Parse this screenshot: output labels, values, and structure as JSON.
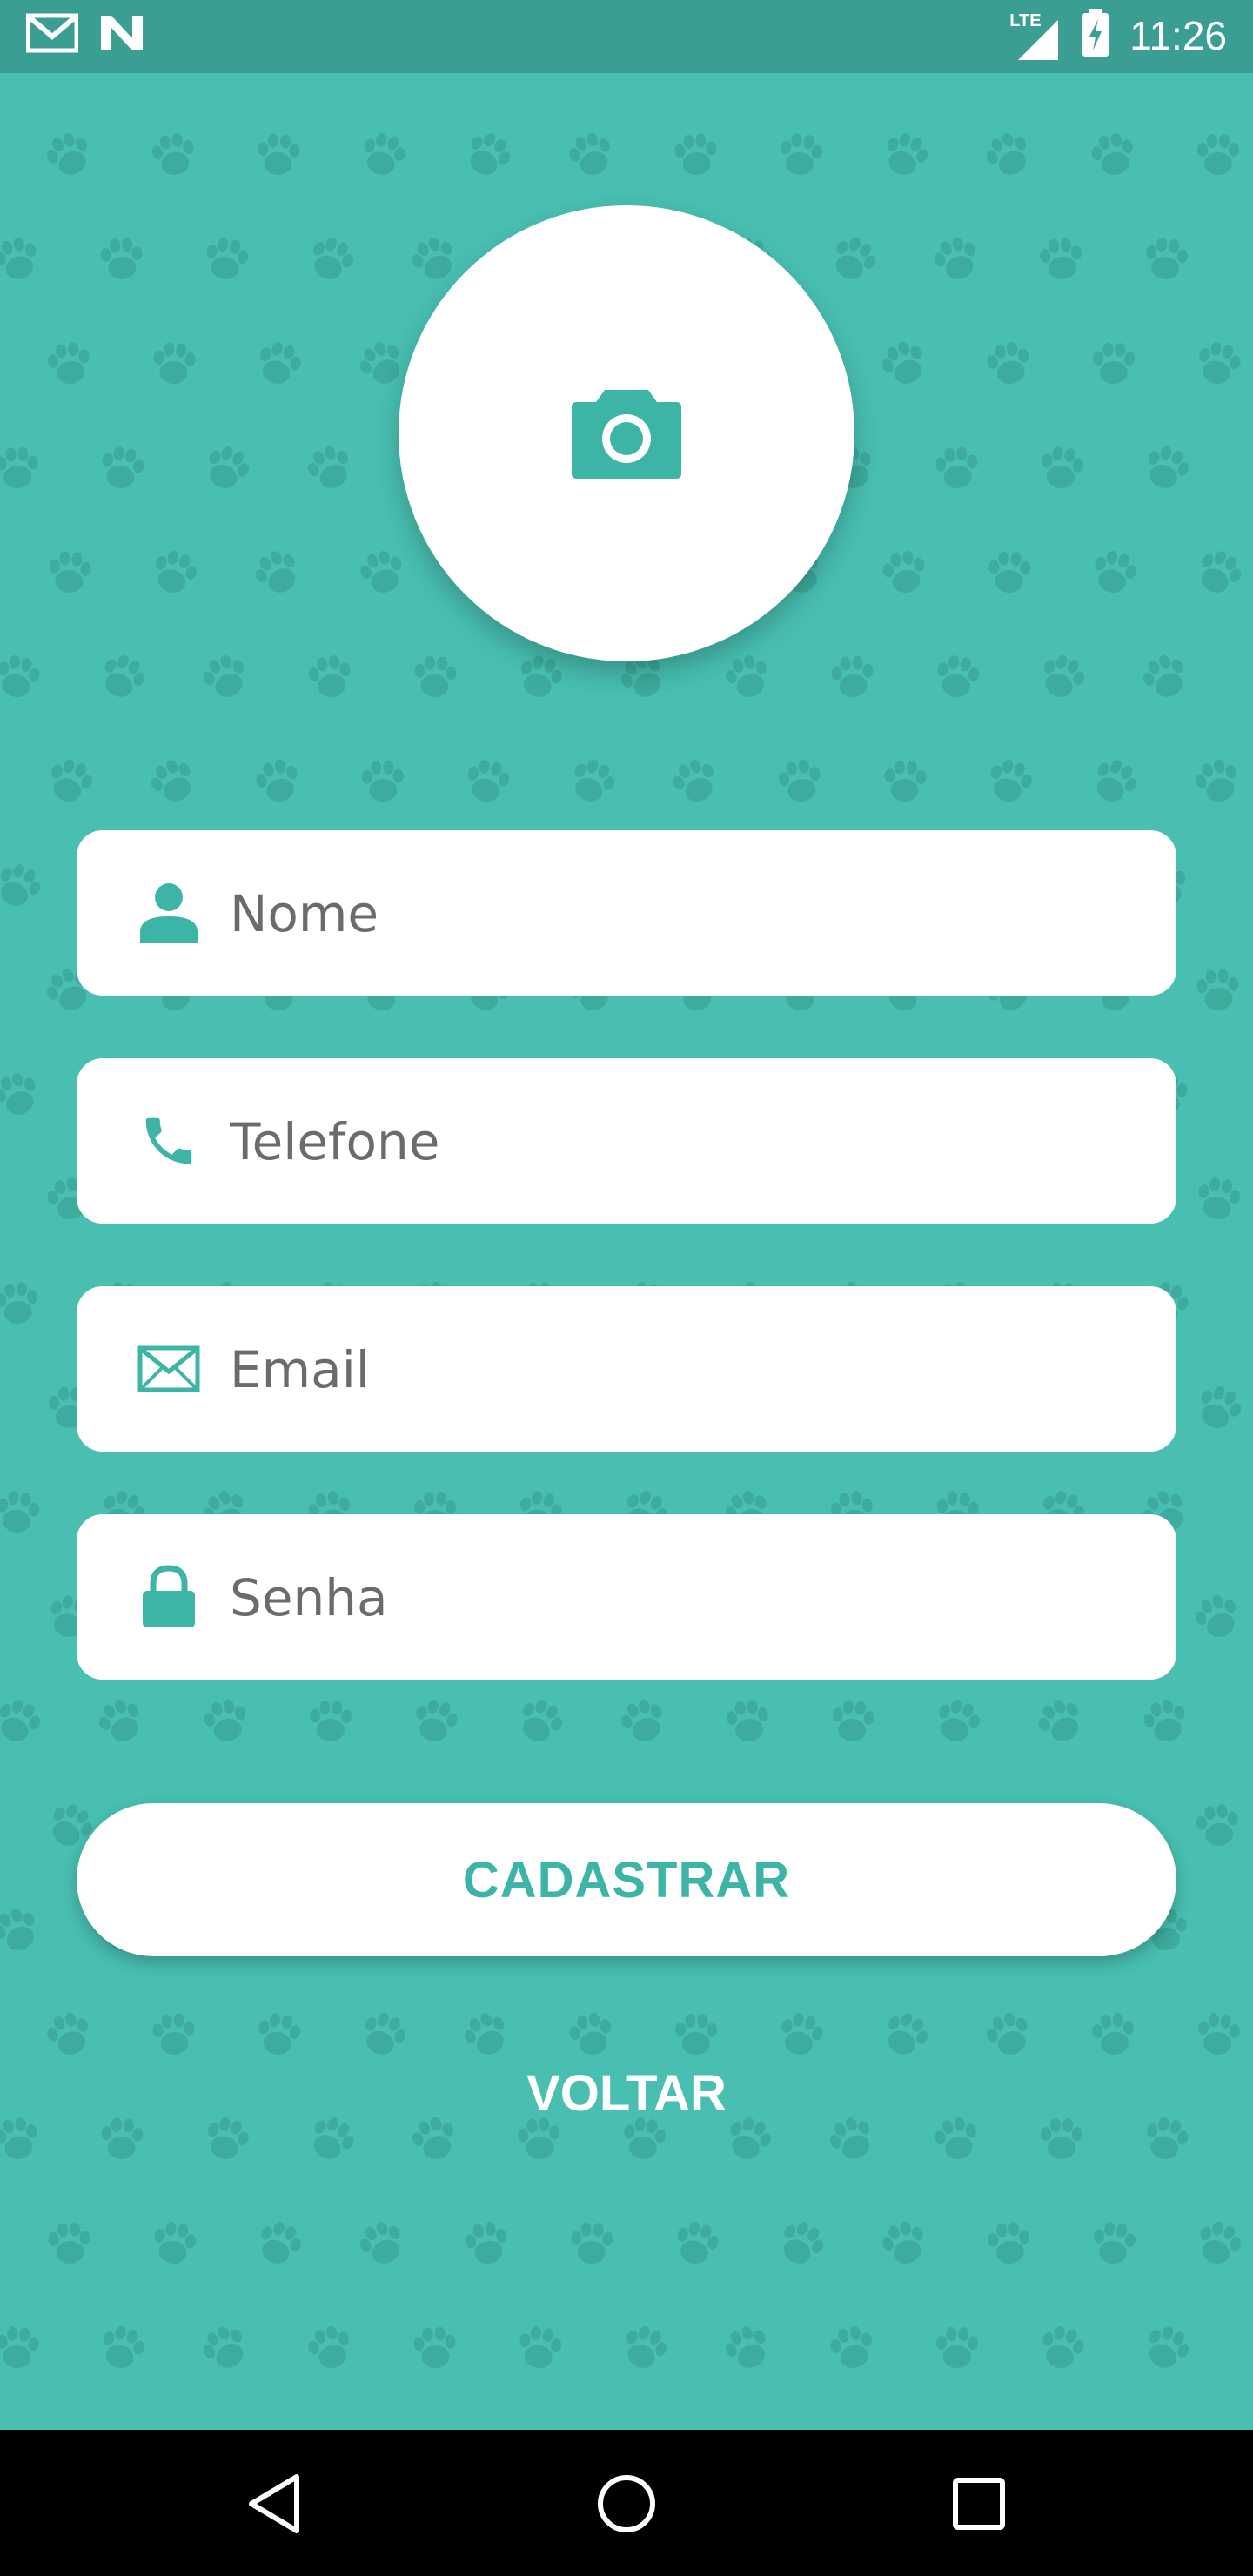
{
  "status_bar": {
    "time": "11:26",
    "network_label": "LTE",
    "left_icons": [
      "gmail-icon",
      "n-app-icon"
    ],
    "right_icons": [
      "signal-icon",
      "battery-charging-icon"
    ]
  },
  "avatar": {
    "icon": "camera-icon"
  },
  "form": {
    "fields": [
      {
        "icon": "person-icon",
        "placeholder": "Nome",
        "value": ""
      },
      {
        "icon": "phone-icon",
        "placeholder": "Telefone",
        "value": ""
      },
      {
        "icon": "mail-icon",
        "placeholder": "Email",
        "value": ""
      },
      {
        "icon": "lock-icon",
        "placeholder": "Senha",
        "value": ""
      }
    ]
  },
  "actions": {
    "primary_label": "CADASTRAR",
    "secondary_label": "VOLTAR"
  },
  "nav_bar": {
    "icons": [
      "back-icon",
      "home-icon",
      "recents-icon"
    ]
  },
  "colors": {
    "background": "#48bfb1",
    "status_bar": "#3a9e93",
    "accent": "#3cb4a6",
    "card": "#ffffff",
    "nav_bar": "#000000"
  }
}
